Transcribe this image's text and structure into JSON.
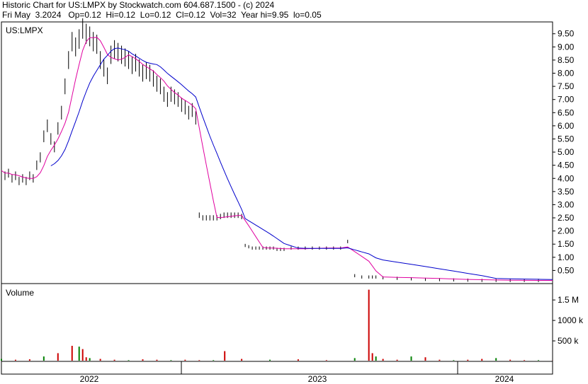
{
  "header": {
    "line1": "Historic Chart for US:LMPX by Stockwatch.com 604.687.1500 - (c) 2024",
    "line2": "Fri May  3.2024   Op=0.12  Hi=0.12  Lo=0.12  Cl=0.12  Vol=32  Year hi=9.95  lo=0.05"
  },
  "colors": {
    "up": "#008000",
    "down": "#cc0000",
    "bar": "#000000",
    "ma_short": "#e000a0",
    "ma_long": "#0000cc",
    "grid": "#000000",
    "background": "#ffffff"
  },
  "chart_data": [
    {
      "type": "line",
      "title": "US:LMPX",
      "xlabel": "",
      "ylabel": "",
      "ylim": [
        0,
        9.95
      ],
      "y_ticks": [
        "9.50",
        "9.00",
        "8.50",
        "8.00",
        "7.50",
        "7.00",
        "6.50",
        "6.00",
        "5.50",
        "5.00",
        "4.50",
        "4.00",
        "3.50",
        "3.00",
        "2.50",
        "2.00",
        "1.50",
        "1.00",
        "0.50"
      ],
      "x_labels": [
        "2022",
        "2023",
        "2024"
      ],
      "legend": "none",
      "grid": false,
      "series": [
        {
          "values_style": "ohlc",
          "x": [
            0,
            5,
            10,
            15,
            20,
            25,
            30,
            35,
            40,
            45,
            50,
            55,
            60,
            65,
            70,
            75,
            80,
            85,
            90,
            95,
            100,
            105,
            110,
            115,
            120,
            125,
            130,
            135,
            140,
            145,
            150,
            155,
            160,
            165,
            170,
            175,
            180,
            185,
            190,
            195,
            200,
            205,
            210,
            215,
            220,
            225,
            230,
            235,
            240,
            245,
            250,
            255,
            260,
            265,
            270,
            275,
            280,
            285,
            290,
            295,
            300,
            305,
            310,
            315,
            320,
            325,
            330,
            335,
            340,
            345,
            350,
            355,
            360,
            365,
            370,
            375,
            380,
            385,
            390,
            395,
            400,
            410,
            420,
            430,
            440,
            450,
            460,
            470,
            480,
            490,
            500,
            510,
            520,
            525,
            530,
            540,
            560,
            580,
            600,
            620,
            640,
            660,
            680,
            700,
            720,
            740,
            760,
            780
          ],
          "values": [
            4.3,
            4.1,
            4.2,
            4.0,
            4.1,
            3.9,
            4.0,
            3.9,
            4.1,
            4.0,
            4.5,
            4.8,
            5.6,
            6.0,
            5.5,
            5.2,
            5.9,
            6.5,
            7.5,
            8.5,
            9.2,
            9.0,
            9.3,
            9.7,
            9.5,
            9.4,
            9.2,
            9.1,
            8.5,
            8.2,
            7.9,
            8.7,
            8.9,
            8.8,
            8.7,
            8.6,
            8.5,
            8.3,
            8.4,
            8.2,
            8.0,
            8.1,
            8.0,
            7.8,
            7.6,
            7.5,
            7.2,
            7.0,
            7.2,
            7.1,
            7.0,
            6.8,
            6.7,
            6.5,
            6.6,
            6.3,
            2.6,
            2.5,
            2.5,
            2.5,
            2.5,
            2.5,
            2.55,
            2.6,
            2.6,
            2.6,
            2.6,
            2.6,
            2.55,
            1.45,
            1.4,
            1.35,
            1.35,
            1.35,
            1.35,
            1.35,
            1.35,
            1.35,
            1.3,
            1.3,
            1.3,
            1.35,
            1.35,
            1.35,
            1.35,
            1.35,
            1.35,
            1.35,
            1.35,
            1.6,
            0.3,
            0.25,
            0.25,
            0.25,
            0.25,
            0.22,
            0.2,
            0.18,
            0.16,
            0.15,
            0.14,
            0.13,
            0.12,
            0.12,
            0.12,
            0.12,
            0.12,
            0.12
          ]
        }
      ]
    },
    {
      "type": "bar",
      "title": "Volume",
      "y_ticks": [
        "1.5 M",
        "1000 k",
        "500 k"
      ],
      "values_note": "daily volume bars",
      "x": [
        0,
        20,
        40,
        60,
        80,
        100,
        110,
        115,
        120,
        125,
        140,
        160,
        180,
        200,
        220,
        240,
        260,
        280,
        300,
        316,
        340,
        380,
        420,
        460,
        500,
        520,
        525,
        530,
        540,
        560,
        580,
        600,
        620,
        640,
        660,
        680,
        700,
        720,
        740,
        760,
        780
      ],
      "values": [
        60000,
        40000,
        50000,
        120000,
        200000,
        380000,
        360000,
        300000,
        100000,
        80000,
        60000,
        40000,
        30000,
        50000,
        40000,
        30000,
        40000,
        30000,
        30000,
        250000,
        60000,
        40000,
        50000,
        30000,
        80000,
        1750000,
        200000,
        120000,
        60000,
        40000,
        120000,
        100000,
        40000,
        30000,
        40000,
        60000,
        80000,
        40000,
        30000,
        30000,
        20000
      ]
    }
  ]
}
